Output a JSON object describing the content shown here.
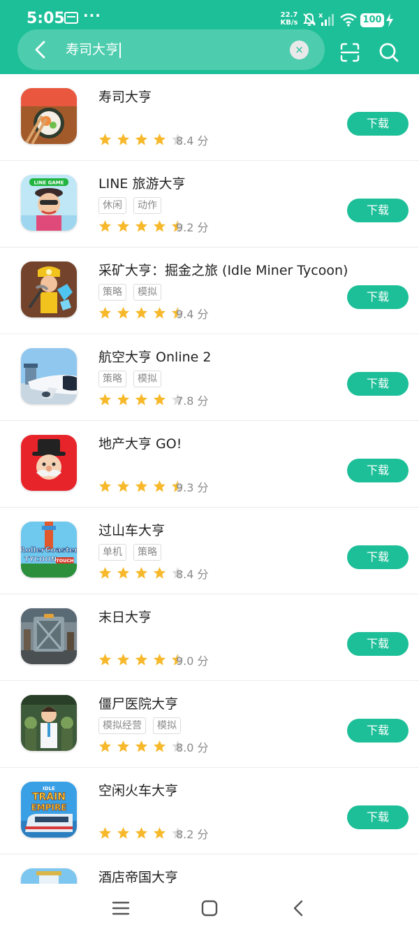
{
  "status_bar": {
    "time": "5:05",
    "dots": "···",
    "net_speed_value": "22.7",
    "net_speed_unit": "KB/s",
    "battery": "100"
  },
  "search": {
    "query": "寿司大亨",
    "clear_label": "×"
  },
  "icons": {
    "back": "back-arrow-icon",
    "scan": "scan-icon",
    "search": "search-icon",
    "clear": "clear-icon"
  },
  "colors": {
    "accent": "#1dbf98",
    "star": "#f7b92b",
    "star_empty": "#dddddd"
  },
  "results": [
    {
      "title": "寿司大亨",
      "tags": [],
      "rating": 4,
      "score_text": "8.4 分",
      "button": "下载",
      "icon_name": "sushi-tycoon-icon"
    },
    {
      "title": "LINE 旅游大亨",
      "tags": [
        "休闲",
        "动作"
      ],
      "rating": 4.5,
      "score_text": "9.2 分",
      "button": "下载",
      "icon_name": "line-tycoon-icon",
      "icon_label": "LINE GAME"
    },
    {
      "title": "采矿大亨：掘金之旅 (Idle Miner Tycoon)",
      "tags": [
        "策略",
        "模拟"
      ],
      "rating": 4.5,
      "score_text": "9.4 分",
      "button": "下载",
      "icon_name": "idle-miner-icon"
    },
    {
      "title": "航空大亨 Online 2",
      "tags": [
        "策略",
        "模拟"
      ],
      "rating": 4,
      "score_text": "7.8 分",
      "button": "下载",
      "icon_name": "airline-tycoon-icon"
    },
    {
      "title": "地产大亨 GO!",
      "tags": [],
      "rating": 4.5,
      "score_text": "9.3 分",
      "button": "下载",
      "icon_name": "monopoly-go-icon"
    },
    {
      "title": "过山车大亨",
      "tags": [
        "单机",
        "策略"
      ],
      "rating": 4,
      "score_text": "8.4 分",
      "button": "下载",
      "icon_name": "roller-coaster-icon",
      "icon_label": "RollerCoaster",
      "icon_label2": "TYCOON",
      "icon_label3": "TOUCH"
    },
    {
      "title": "末日大亨",
      "tags": [],
      "rating": 4.5,
      "score_text": "9.0 分",
      "button": "下载",
      "icon_name": "doomsday-tycoon-icon"
    },
    {
      "title": "僵尸医院大亨",
      "tags": [
        "模拟经营",
        "模拟"
      ],
      "rating": 4,
      "score_text": "8.0 分",
      "button": "下载",
      "icon_name": "zombie-hospital-icon"
    },
    {
      "title": "空闲火车大亨",
      "tags": [],
      "rating": 4,
      "score_text": "8.2 分",
      "button": "下载",
      "icon_name": "train-empire-icon",
      "icon_label": "IDLE",
      "icon_label2": "TRAIN",
      "icon_label3": "EMPIRE"
    },
    {
      "title": "酒店帝国大亨",
      "tags": [],
      "rating": 0,
      "score_text": "",
      "button": "",
      "icon_name": "hotel-empire-icon"
    }
  ],
  "nav": {
    "menu": "menu-icon",
    "home": "home-icon",
    "back": "nav-back-icon"
  }
}
